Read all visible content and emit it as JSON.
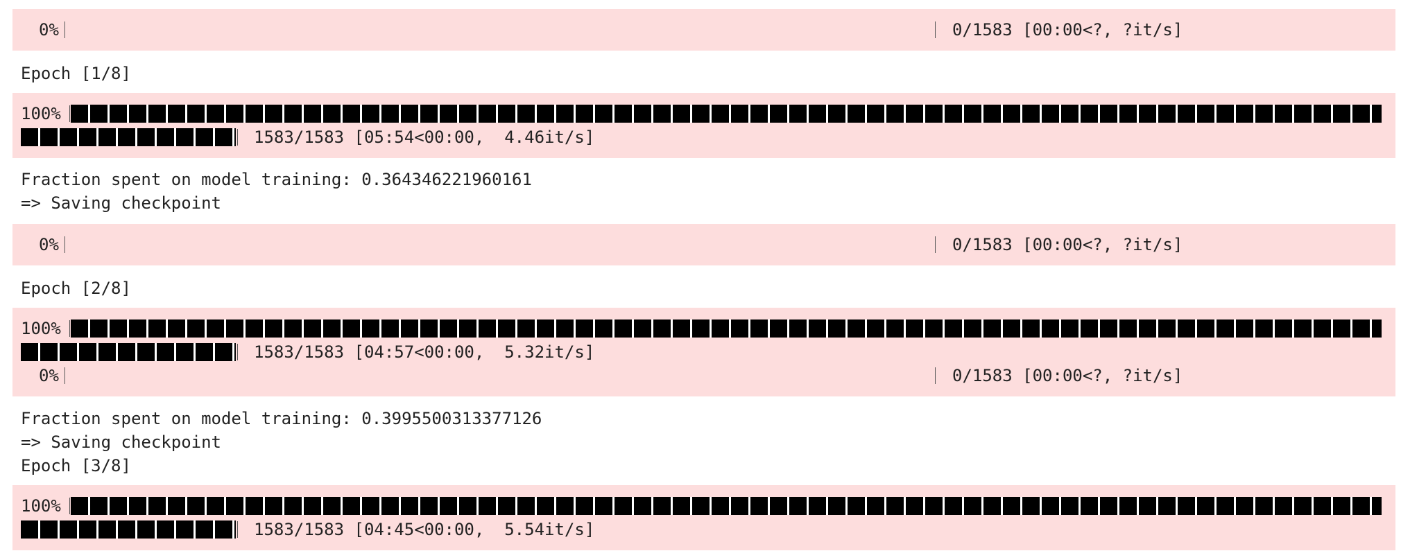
{
  "output_blocks": [
    {
      "kind": "progress",
      "percent": "0%",
      "progress_fraction": 0.0,
      "stats": "0/1583 [00:00<?, ?it/s]"
    },
    {
      "kind": "text",
      "lines": [
        "Epoch [1/8]"
      ]
    },
    {
      "kind": "progress",
      "percent": "100%",
      "progress_fraction": 1.0,
      "stats": "1583/1583 [05:54<00:00,  4.46it/s]"
    },
    {
      "kind": "text",
      "lines": [
        "Fraction spent on model training: 0.364346221960161",
        "=> Saving checkpoint"
      ]
    },
    {
      "kind": "progress",
      "percent": "0%",
      "progress_fraction": 0.0,
      "stats": "0/1583 [00:00<?, ?it/s]"
    },
    {
      "kind": "text",
      "lines": [
        "Epoch [2/8]"
      ]
    },
    {
      "kind": "progress",
      "percent": "100%",
      "progress_fraction": 1.0,
      "stats": "1583/1583 [04:57<00:00,  5.32it/s]"
    },
    {
      "kind": "progress",
      "percent": "0%",
      "progress_fraction": 0.0,
      "stats": "0/1583 [00:00<?, ?it/s]"
    },
    {
      "kind": "text",
      "lines": [
        "Fraction spent on model training: 0.3995500313377126",
        "=> Saving checkpoint",
        "Epoch [3/8]"
      ]
    },
    {
      "kind": "progress",
      "percent": "100%",
      "progress_fraction": 1.0,
      "stats": "1583/1583 [04:45<00:00,  5.54it/s]"
    }
  ],
  "colors": {
    "stderr_background": "#fddddd",
    "text": "#222222",
    "bar_fill": "#000000"
  }
}
